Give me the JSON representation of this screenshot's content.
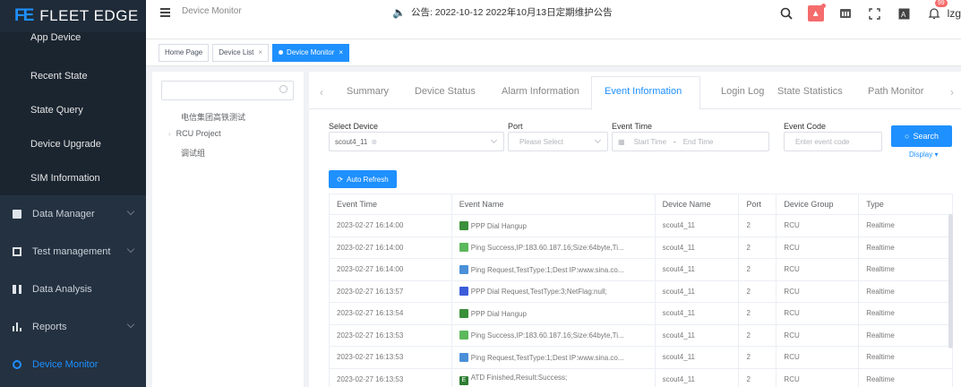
{
  "brand": {
    "logo_mark": "FE",
    "name": "FLEET EDGE"
  },
  "sidebar": {
    "sub_items": [
      "App Device",
      "Recent State",
      "State Query",
      "Device Upgrade",
      "SIM Information"
    ],
    "main_items": [
      {
        "label": "Data Manager",
        "icon": "folder-icon",
        "has_chevron": true
      },
      {
        "label": "Test management",
        "icon": "grid-icon",
        "has_chevron": true
      },
      {
        "label": "Data Analysis",
        "icon": "analysis-icon",
        "has_chevron": false
      },
      {
        "label": "Reports",
        "icon": "bar-chart-icon",
        "has_chevron": true
      },
      {
        "label": "Device Monitor",
        "icon": "monitor-icon",
        "has_chevron": false,
        "active": true
      }
    ]
  },
  "header": {
    "title": "Device Monitor",
    "notice": "公告: 2022-10-12 2022年10月13日定期维护公告",
    "bell_count": "99",
    "user": "lzg"
  },
  "tags": [
    "Home Page",
    "Device List",
    "Device Monitor"
  ],
  "tree": {
    "search_placeholder": "",
    "nodes": [
      "电信集团高铁测试",
      "RCU Project",
      "调试组"
    ]
  },
  "tabs": [
    "Summary",
    "Device Status",
    "Alarm Information",
    "Event Information",
    "Login Log",
    "State Statistics",
    "Path Monitor"
  ],
  "active_tab": "Event Information",
  "filters": {
    "select_device_label": "Select Device",
    "select_device_value": "scout4_11",
    "port_label": "Port",
    "port_placeholder": "Please Select",
    "event_time_label": "Event Time",
    "start_time_placeholder": "Start Time",
    "range_sep": "-",
    "end_time_placeholder": "End Time",
    "event_code_label": "Event Code",
    "event_code_placeholder": "Enter event code",
    "search_label": "Search",
    "display_label": "Display ▾",
    "auto_refresh_label": "Auto Refresh"
  },
  "table": {
    "columns": [
      "Event Time",
      "Event Name",
      "Device Name",
      "Port",
      "Device Group",
      "Type"
    ],
    "rows": [
      {
        "time": "2023-02-27 16:14:00",
        "icon": "dial-icon",
        "icon_color": "#3a8f3a",
        "name": "PPP Dial Hangup",
        "device": "scout4_11",
        "port": "2",
        "group": "RCU",
        "type": "Realtime"
      },
      {
        "time": "2023-02-27 16:14:00",
        "icon": "ping-icon",
        "icon_color": "#5cb85c",
        "name": "Ping Success,IP:183.60.187.16;Size:64byte,Ti...",
        "device": "scout4_11",
        "port": "2",
        "group": "RCU",
        "type": "Realtime"
      },
      {
        "time": "2023-02-27 16:14:00",
        "icon": "request-icon",
        "icon_color": "#4a90d9",
        "name": "Ping Request,TestType:1;Dest IP:www.sina.co...",
        "device": "scout4_11",
        "port": "2",
        "group": "RCU",
        "type": "Realtime"
      },
      {
        "time": "2023-02-27 16:13:57",
        "icon": "dial-request-icon",
        "icon_color": "#3b5bdb",
        "name": "PPP Dial Request,TestType:3;NetFlag:null;",
        "device": "scout4_11",
        "port": "2",
        "group": "RCU",
        "type": "Realtime"
      },
      {
        "time": "2023-02-27 16:13:54",
        "icon": "dial-icon",
        "icon_color": "#3a8f3a",
        "name": "PPP Dial Hangup",
        "device": "scout4_11",
        "port": "2",
        "group": "RCU",
        "type": "Realtime"
      },
      {
        "time": "2023-02-27 16:13:53",
        "icon": "ping-icon",
        "icon_color": "#5cb85c",
        "name": "Ping Success,IP:183.60.187.16;Size:64byte,Ti...",
        "device": "scout4_11",
        "port": "2",
        "group": "RCU",
        "type": "Realtime"
      },
      {
        "time": "2023-02-27 16:13:53",
        "icon": "request-icon",
        "icon_color": "#4a90d9",
        "name": "Ping Request,TestType:1;Dest IP:www.sina.co...",
        "device": "scout4_11",
        "port": "2",
        "group": "RCU",
        "type": "Realtime"
      },
      {
        "time": "2023-02-27 16:13:53",
        "icon": "finished-icon",
        "icon_color": "#2e7d32",
        "icon_text": "E",
        "name": "ATD Finished,Result:Success;",
        "device": "scout4_11",
        "port": "2",
        "group": "RCU",
        "type": "Realtime"
      }
    ]
  },
  "colors": {
    "accent": "#1e90ff",
    "sidebar": "#243140",
    "badge": "#f56c6c"
  }
}
